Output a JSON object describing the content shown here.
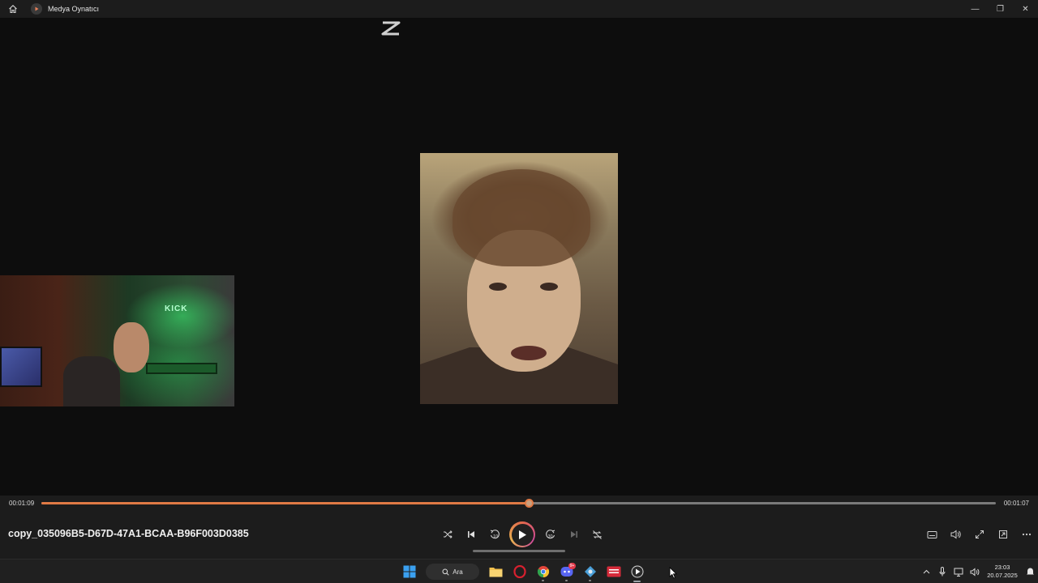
{
  "window": {
    "title": "Medya Oynatıcı",
    "minimize_glyph": "—",
    "maximize_glyph": "❐",
    "close_glyph": "✕"
  },
  "video": {
    "overlay_logo": "capcut-logo",
    "main_frame": "face-closeup",
    "pip_frame": "streamer-room",
    "pip_sign_text": "KICK"
  },
  "player": {
    "current_time": "00:01:09",
    "total_time": "00:01:07",
    "progress_fraction": 0.511,
    "filename": "copy_035096B5-D67D-47A1-BCAA-B96F003D0385",
    "skip_back_label": "10",
    "skip_forward_label": "30",
    "accent_color": "#e07a45"
  },
  "taskbar": {
    "search_label": "Ara",
    "discord_badge": "9+",
    "clock_time": "23:03",
    "clock_date": "20.07.2025"
  }
}
